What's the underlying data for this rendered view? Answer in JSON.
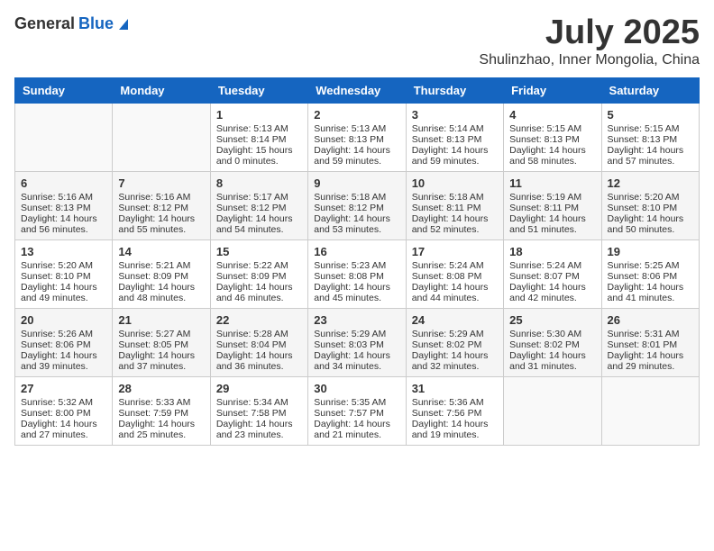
{
  "logo": {
    "general": "General",
    "blue": "Blue"
  },
  "title": "July 2025",
  "location": "Shulinzhao, Inner Mongolia, China",
  "days_of_week": [
    "Sunday",
    "Monday",
    "Tuesday",
    "Wednesday",
    "Thursday",
    "Friday",
    "Saturday"
  ],
  "weeks": [
    [
      {
        "day": "",
        "sunrise": "",
        "sunset": "",
        "daylight": ""
      },
      {
        "day": "",
        "sunrise": "",
        "sunset": "",
        "daylight": ""
      },
      {
        "day": "1",
        "sunrise": "Sunrise: 5:13 AM",
        "sunset": "Sunset: 8:14 PM",
        "daylight": "Daylight: 15 hours and 0 minutes."
      },
      {
        "day": "2",
        "sunrise": "Sunrise: 5:13 AM",
        "sunset": "Sunset: 8:13 PM",
        "daylight": "Daylight: 14 hours and 59 minutes."
      },
      {
        "day": "3",
        "sunrise": "Sunrise: 5:14 AM",
        "sunset": "Sunset: 8:13 PM",
        "daylight": "Daylight: 14 hours and 59 minutes."
      },
      {
        "day": "4",
        "sunrise": "Sunrise: 5:15 AM",
        "sunset": "Sunset: 8:13 PM",
        "daylight": "Daylight: 14 hours and 58 minutes."
      },
      {
        "day": "5",
        "sunrise": "Sunrise: 5:15 AM",
        "sunset": "Sunset: 8:13 PM",
        "daylight": "Daylight: 14 hours and 57 minutes."
      }
    ],
    [
      {
        "day": "6",
        "sunrise": "Sunrise: 5:16 AM",
        "sunset": "Sunset: 8:13 PM",
        "daylight": "Daylight: 14 hours and 56 minutes."
      },
      {
        "day": "7",
        "sunrise": "Sunrise: 5:16 AM",
        "sunset": "Sunset: 8:12 PM",
        "daylight": "Daylight: 14 hours and 55 minutes."
      },
      {
        "day": "8",
        "sunrise": "Sunrise: 5:17 AM",
        "sunset": "Sunset: 8:12 PM",
        "daylight": "Daylight: 14 hours and 54 minutes."
      },
      {
        "day": "9",
        "sunrise": "Sunrise: 5:18 AM",
        "sunset": "Sunset: 8:12 PM",
        "daylight": "Daylight: 14 hours and 53 minutes."
      },
      {
        "day": "10",
        "sunrise": "Sunrise: 5:18 AM",
        "sunset": "Sunset: 8:11 PM",
        "daylight": "Daylight: 14 hours and 52 minutes."
      },
      {
        "day": "11",
        "sunrise": "Sunrise: 5:19 AM",
        "sunset": "Sunset: 8:11 PM",
        "daylight": "Daylight: 14 hours and 51 minutes."
      },
      {
        "day": "12",
        "sunrise": "Sunrise: 5:20 AM",
        "sunset": "Sunset: 8:10 PM",
        "daylight": "Daylight: 14 hours and 50 minutes."
      }
    ],
    [
      {
        "day": "13",
        "sunrise": "Sunrise: 5:20 AM",
        "sunset": "Sunset: 8:10 PM",
        "daylight": "Daylight: 14 hours and 49 minutes."
      },
      {
        "day": "14",
        "sunrise": "Sunrise: 5:21 AM",
        "sunset": "Sunset: 8:09 PM",
        "daylight": "Daylight: 14 hours and 48 minutes."
      },
      {
        "day": "15",
        "sunrise": "Sunrise: 5:22 AM",
        "sunset": "Sunset: 8:09 PM",
        "daylight": "Daylight: 14 hours and 46 minutes."
      },
      {
        "day": "16",
        "sunrise": "Sunrise: 5:23 AM",
        "sunset": "Sunset: 8:08 PM",
        "daylight": "Daylight: 14 hours and 45 minutes."
      },
      {
        "day": "17",
        "sunrise": "Sunrise: 5:24 AM",
        "sunset": "Sunset: 8:08 PM",
        "daylight": "Daylight: 14 hours and 44 minutes."
      },
      {
        "day": "18",
        "sunrise": "Sunrise: 5:24 AM",
        "sunset": "Sunset: 8:07 PM",
        "daylight": "Daylight: 14 hours and 42 minutes."
      },
      {
        "day": "19",
        "sunrise": "Sunrise: 5:25 AM",
        "sunset": "Sunset: 8:06 PM",
        "daylight": "Daylight: 14 hours and 41 minutes."
      }
    ],
    [
      {
        "day": "20",
        "sunrise": "Sunrise: 5:26 AM",
        "sunset": "Sunset: 8:06 PM",
        "daylight": "Daylight: 14 hours and 39 minutes."
      },
      {
        "day": "21",
        "sunrise": "Sunrise: 5:27 AM",
        "sunset": "Sunset: 8:05 PM",
        "daylight": "Daylight: 14 hours and 37 minutes."
      },
      {
        "day": "22",
        "sunrise": "Sunrise: 5:28 AM",
        "sunset": "Sunset: 8:04 PM",
        "daylight": "Daylight: 14 hours and 36 minutes."
      },
      {
        "day": "23",
        "sunrise": "Sunrise: 5:29 AM",
        "sunset": "Sunset: 8:03 PM",
        "daylight": "Daylight: 14 hours and 34 minutes."
      },
      {
        "day": "24",
        "sunrise": "Sunrise: 5:29 AM",
        "sunset": "Sunset: 8:02 PM",
        "daylight": "Daylight: 14 hours and 32 minutes."
      },
      {
        "day": "25",
        "sunrise": "Sunrise: 5:30 AM",
        "sunset": "Sunset: 8:02 PM",
        "daylight": "Daylight: 14 hours and 31 minutes."
      },
      {
        "day": "26",
        "sunrise": "Sunrise: 5:31 AM",
        "sunset": "Sunset: 8:01 PM",
        "daylight": "Daylight: 14 hours and 29 minutes."
      }
    ],
    [
      {
        "day": "27",
        "sunrise": "Sunrise: 5:32 AM",
        "sunset": "Sunset: 8:00 PM",
        "daylight": "Daylight: 14 hours and 27 minutes."
      },
      {
        "day": "28",
        "sunrise": "Sunrise: 5:33 AM",
        "sunset": "Sunset: 7:59 PM",
        "daylight": "Daylight: 14 hours and 25 minutes."
      },
      {
        "day": "29",
        "sunrise": "Sunrise: 5:34 AM",
        "sunset": "Sunset: 7:58 PM",
        "daylight": "Daylight: 14 hours and 23 minutes."
      },
      {
        "day": "30",
        "sunrise": "Sunrise: 5:35 AM",
        "sunset": "Sunset: 7:57 PM",
        "daylight": "Daylight: 14 hours and 21 minutes."
      },
      {
        "day": "31",
        "sunrise": "Sunrise: 5:36 AM",
        "sunset": "Sunset: 7:56 PM",
        "daylight": "Daylight: 14 hours and 19 minutes."
      },
      {
        "day": "",
        "sunrise": "",
        "sunset": "",
        "daylight": ""
      },
      {
        "day": "",
        "sunrise": "",
        "sunset": "",
        "daylight": ""
      }
    ]
  ]
}
